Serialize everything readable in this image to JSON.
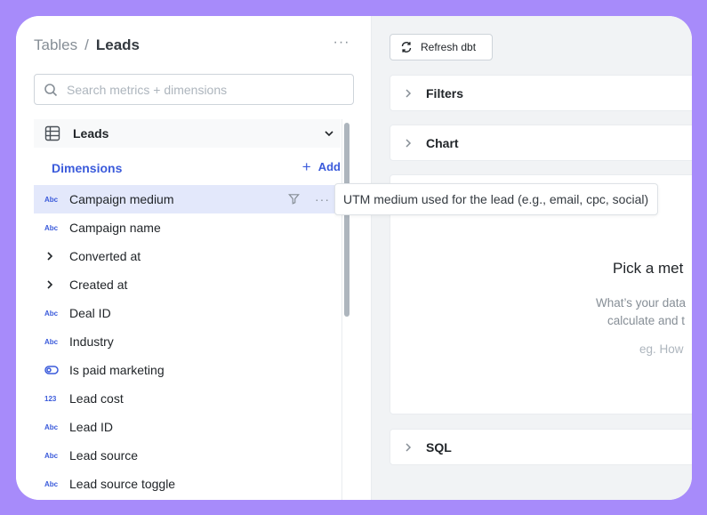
{
  "breadcrumb": {
    "parent": "Tables",
    "separator": "/",
    "current": "Leads"
  },
  "search": {
    "placeholder": "Search metrics + dimensions",
    "value": ""
  },
  "table": {
    "name": "Leads"
  },
  "dimensions": {
    "label": "Dimensions",
    "add_label": "Add",
    "items": [
      {
        "label": "Campaign medium",
        "type": "text",
        "type_label": "Abc",
        "selected": true
      },
      {
        "label": "Campaign name",
        "type": "text",
        "type_label": "Abc"
      },
      {
        "label": "Converted at",
        "type": "group"
      },
      {
        "label": "Created at",
        "type": "group"
      },
      {
        "label": "Deal ID",
        "type": "text",
        "type_label": "Abc"
      },
      {
        "label": "Industry",
        "type": "text",
        "type_label": "Abc"
      },
      {
        "label": "Is paid marketing",
        "type": "boolean"
      },
      {
        "label": "Lead cost",
        "type": "number",
        "type_label": "123"
      },
      {
        "label": "Lead ID",
        "type": "text",
        "type_label": "Abc"
      },
      {
        "label": "Lead source",
        "type": "text",
        "type_label": "Abc"
      },
      {
        "label": "Lead source toggle",
        "type": "text",
        "type_label": "Abc"
      }
    ]
  },
  "tooltip": {
    "text": "UTM medium used for the lead (e.g., email, cpc, social)"
  },
  "toolbar": {
    "refresh_label": "Refresh dbt"
  },
  "sections": {
    "filters": "Filters",
    "chart": "Chart",
    "sql": "SQL"
  },
  "empty_state": {
    "title": "Pick a met",
    "subtitle_line1": "What’s your data",
    "subtitle_line2": "calculate and t",
    "example": "eg. How"
  },
  "colors": {
    "accent": "#3b5bdb",
    "background": "#a78bfa",
    "selected_row": "#e3e8fb"
  }
}
